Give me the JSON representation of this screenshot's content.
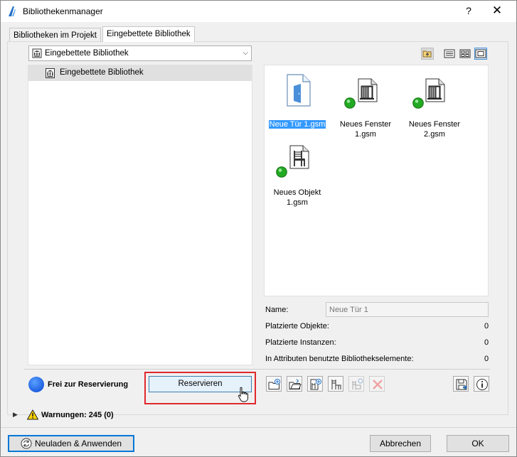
{
  "window": {
    "title": "Bibliothekenmanager",
    "help_label": "?",
    "close_label": "✕"
  },
  "tabs": [
    {
      "label": "Bibliotheken im Projekt"
    },
    {
      "label": "Eingebettete Bibliothek"
    }
  ],
  "source_select": {
    "value": "Eingebettete Bibliothek"
  },
  "tree": {
    "items": [
      {
        "label": "Eingebettete Bibliothek",
        "icon": "library-icon"
      }
    ]
  },
  "view_toolbar": [
    {
      "icon": "folder-up-icon"
    },
    {
      "icon": "list-view-icon"
    },
    {
      "icon": "grid-view-icon"
    },
    {
      "icon": "large-icon-view-icon",
      "active": true
    }
  ],
  "files": [
    {
      "label": "Neue Tür 1.gsm",
      "icon": "door-file-icon",
      "selected": true
    },
    {
      "label": "Neues Fenster 1.gsm",
      "icon": "window-object-icon",
      "status": "green"
    },
    {
      "label": "Neues Fenster 2.gsm",
      "icon": "window-object-icon",
      "status": "green"
    },
    {
      "label": "Neues Objekt 1.gsm",
      "icon": "chair-object-icon",
      "status": "green"
    }
  ],
  "info": {
    "name_label": "Name:",
    "name_value": "Neue Tür 1",
    "placed_objects_label": "Platzierte Objekte:",
    "placed_objects_value": "0",
    "placed_instances_label": "Platzierte Instanzen:",
    "placed_instances_value": "0",
    "attr_elements_label": "In Attributen benutzte Bibliothekselemente:",
    "attr_elements_value": "0"
  },
  "reservation": {
    "status_text": "Frei zur Reservierung",
    "reserve_label": "Reservieren"
  },
  "action_buttons": [
    {
      "icon": "new-folder-icon"
    },
    {
      "icon": "open-folder-icon"
    },
    {
      "icon": "add-object-icon"
    },
    {
      "icon": "object-settings-icon"
    },
    {
      "icon": "object-link-icon",
      "disabled": true
    },
    {
      "icon": "delete-icon",
      "disabled": true
    },
    {
      "icon": "save-icon"
    },
    {
      "icon": "info-icon"
    }
  ],
  "warnings": {
    "label": "Warnungen: 245 (0)"
  },
  "footer": {
    "reload_label": "Neuladen & Anwenden",
    "cancel_label": "Abbrechen",
    "ok_label": "OK"
  },
  "colors": {
    "selection": "#3399ff",
    "highlight": "#e0282d",
    "status_dot": "#1e5fe0",
    "status_green": "#22aa22"
  }
}
